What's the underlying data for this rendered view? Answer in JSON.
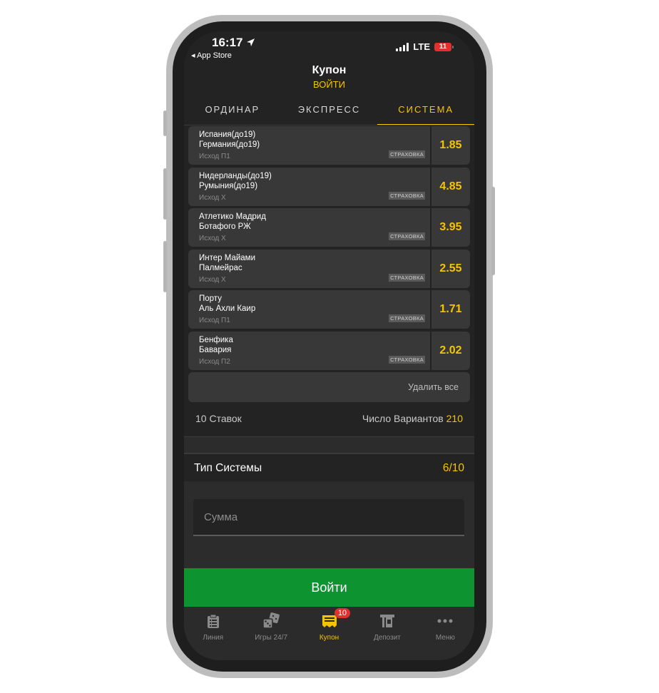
{
  "status_bar": {
    "time": "16:17",
    "back_app": "◂ App Store",
    "network": "LTE",
    "battery": "11"
  },
  "header": {
    "title": "Купон",
    "login_link": "ВОЙТИ"
  },
  "tabs": [
    {
      "label": "ОРДИНАР",
      "active": false
    },
    {
      "label": "ЭКСПРЕСС",
      "active": false
    },
    {
      "label": "СИСТЕМА",
      "active": true
    }
  ],
  "bets": [
    {
      "team1": "Испания(до19)",
      "team2": "Германия(до19)",
      "outcome": "Исход П1",
      "insurance": "СТРАХОВКА",
      "odds": "1.85"
    },
    {
      "team1": "Нидерланды(до19)",
      "team2": "Румыния(до19)",
      "outcome": "Исход X",
      "insurance": "СТРАХОВКА",
      "odds": "4.85"
    },
    {
      "team1": "Атлетико Мадрид",
      "team2": "Ботафого РЖ",
      "outcome": "Исход X",
      "insurance": "СТРАХОВКА",
      "odds": "3.95"
    },
    {
      "team1": "Интер Майами",
      "team2": "Палмейрас",
      "outcome": "Исход X",
      "insurance": "СТРАХОВКА",
      "odds": "2.55"
    },
    {
      "team1": "Порту",
      "team2": "Аль Ахли Каир",
      "outcome": "Исход П1",
      "insurance": "СТРАХОВКА",
      "odds": "1.71"
    },
    {
      "team1": "Бенфика",
      "team2": "Бавария",
      "outcome": "Исход П2",
      "insurance": "СТРАХОВКА",
      "odds": "2.02"
    }
  ],
  "delete_all": "Удалить все",
  "summary": {
    "bets_count": "10 Ставок",
    "variants_label": "Число Вариантов",
    "variants_value": "210"
  },
  "system_type": {
    "label": "Тип Системы",
    "value": "6/10"
  },
  "amount": {
    "placeholder": "Сумма"
  },
  "login_button": "Войти",
  "bottom_nav": [
    {
      "label": "Линия",
      "icon": "clipboard-icon",
      "active": false
    },
    {
      "label": "Игры 24/7",
      "icon": "dice-icon",
      "active": false
    },
    {
      "label": "Купон",
      "icon": "ticket-icon",
      "active": true,
      "badge": "10"
    },
    {
      "label": "Депозит",
      "icon": "deposit-icon",
      "active": false
    },
    {
      "label": "Меню",
      "icon": "more-icon",
      "active": false
    }
  ],
  "colors": {
    "accent": "#f5c400",
    "primary_button": "#0e9331",
    "badge": "#e0312f",
    "background": "#232323"
  }
}
